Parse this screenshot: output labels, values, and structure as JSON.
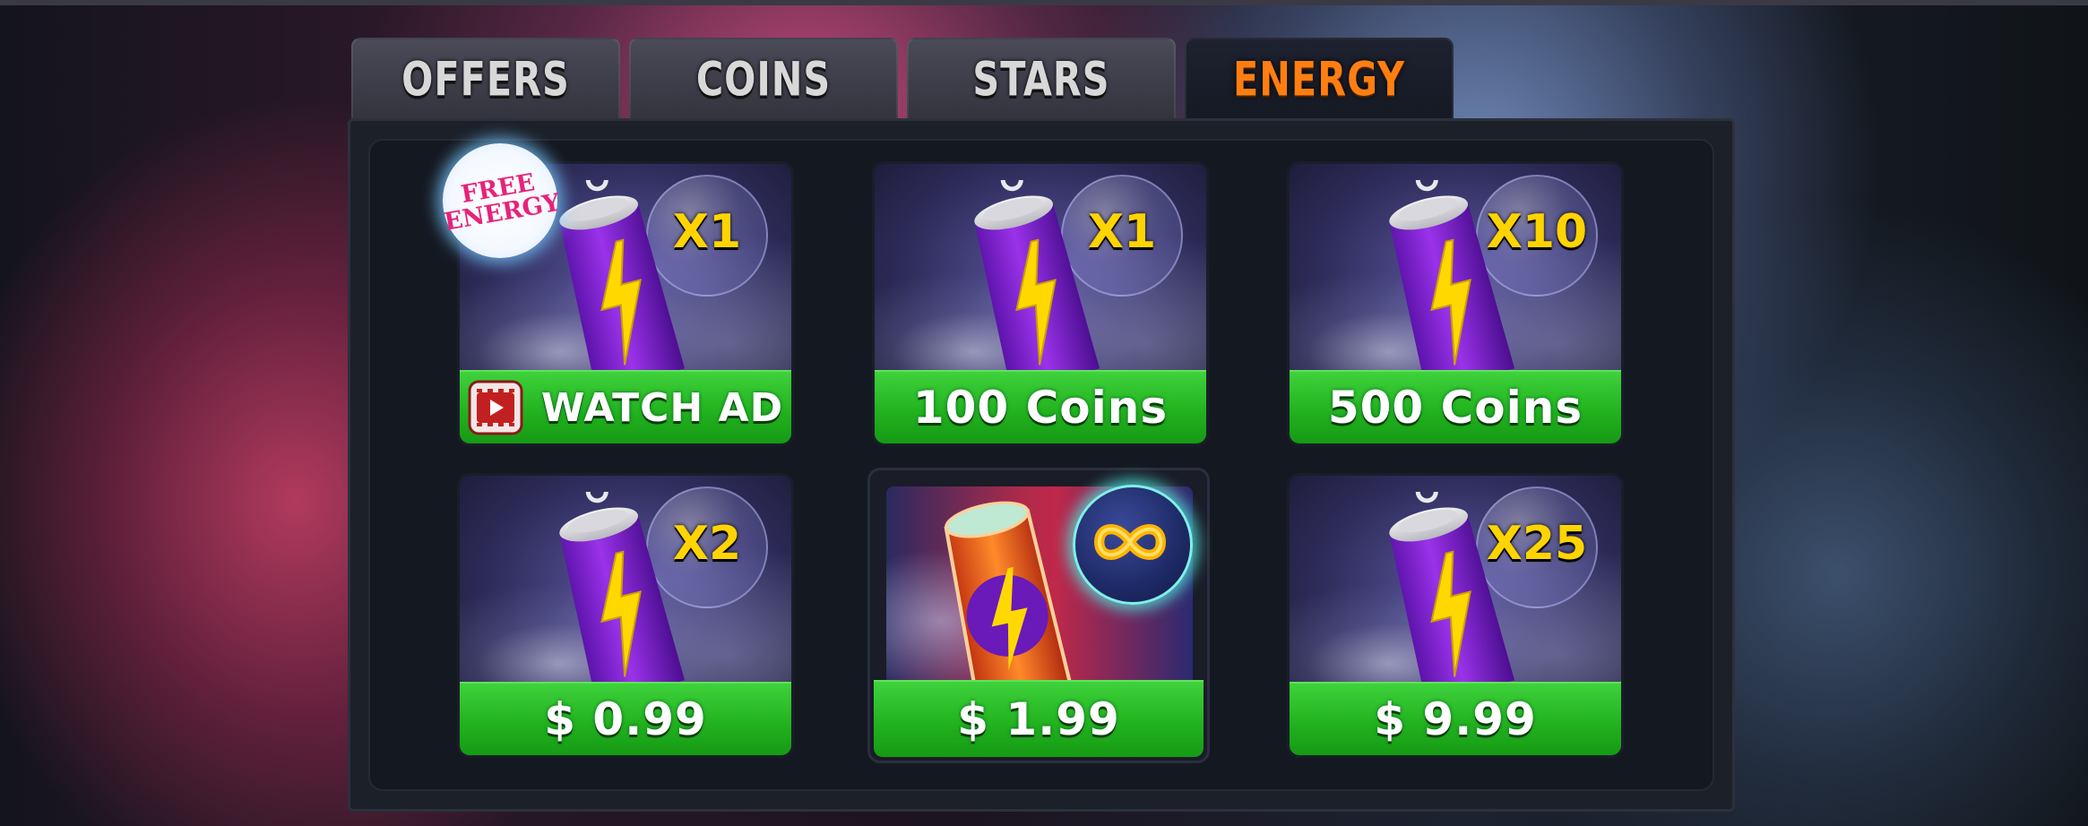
{
  "tabs": [
    {
      "label": "OFFERS",
      "active": false
    },
    {
      "label": "COINS",
      "active": false
    },
    {
      "label": "STARS",
      "active": false
    },
    {
      "label": "ENERGY",
      "active": true
    }
  ],
  "badge": {
    "line1": "FREE",
    "line2": "ENERGY"
  },
  "items": [
    {
      "multiplier": "X1",
      "price": "WATCH AD",
      "icon": "video-ad-icon"
    },
    {
      "multiplier": "X1",
      "price": "100 Coins"
    },
    {
      "multiplier": "X10",
      "price": "500 Coins"
    },
    {
      "multiplier": "X2",
      "price": "$ 0.99"
    },
    {
      "multiplier": "∞",
      "price": "$ 1.99",
      "icon": "infinity-icon"
    },
    {
      "multiplier": "X25",
      "price": "$ 9.99"
    }
  ],
  "colors": {
    "active_tab": "#ff7e12",
    "price_green": "#22b31f",
    "multiplier_yellow": "#ffd400",
    "can_purple": "#8a2be2",
    "badge_pink": "#e8227a"
  }
}
